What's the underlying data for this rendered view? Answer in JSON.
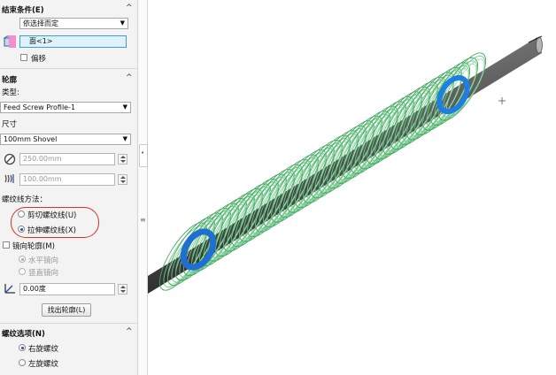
{
  "panel": {
    "end_condition": {
      "title": "结束条件(E)",
      "combo_value": "依选择而定",
      "face_field": "面<1>",
      "offset_label": "偏移"
    },
    "profile": {
      "title": "轮廓",
      "type_label": "类型:",
      "type_value": "Feed Screw Profile-1",
      "size_label": "尺寸",
      "size_value": "100mm Shovel",
      "diameter_value": "250.00mm",
      "pitch_value": "100.00mm",
      "method_label": "螺纹线方法：",
      "method_options": [
        "剪切螺纹线(U)",
        "拉伸螺纹线(X)"
      ],
      "method_selected": "拉伸螺纹线(X)",
      "mirror_label": "镜向轮廓(M)",
      "mirror_options": [
        "水平镜向",
        "竖直镜向"
      ],
      "angle_value": "0.00度",
      "locate_button": "找出轮廓(L)"
    },
    "thread_options": {
      "title": "螺纹选项(N)",
      "options": [
        "右旋螺纹",
        "左旋螺纹"
      ],
      "selected": "右旋螺纹"
    }
  },
  "viewport": {
    "shaft_color": "#5b5b5b",
    "thread_color": "#59c074",
    "end_ring_color": "#1f7fe0"
  },
  "icons": [
    "face-select-icon",
    "diameter-icon",
    "pitch-icon",
    "angle-icon",
    "collapse-caret-icon"
  ]
}
